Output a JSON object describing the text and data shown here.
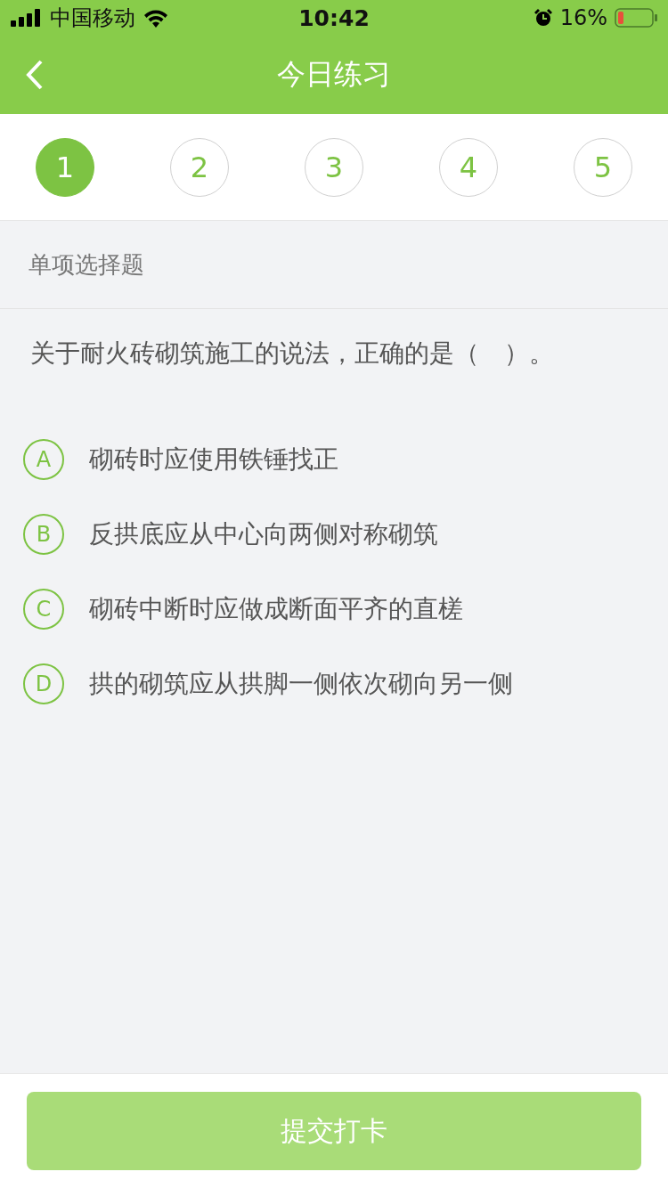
{
  "status_bar": {
    "carrier": "中国移动",
    "time": "10:42",
    "battery": "16%"
  },
  "nav": {
    "title": "今日练习"
  },
  "steps": [
    {
      "label": "1",
      "selected": true
    },
    {
      "label": "2",
      "selected": false
    },
    {
      "label": "3",
      "selected": false
    },
    {
      "label": "4",
      "selected": false
    },
    {
      "label": "5",
      "selected": false
    }
  ],
  "question": {
    "type_label": "单项选择题",
    "text": "关于耐火砖砌筑施工的说法，正确的是（　）。",
    "options": [
      {
        "letter": "A",
        "text": "砌砖时应使用铁锤找正",
        "selected": false
      },
      {
        "letter": "B",
        "text": "反拱底应从中心向两侧对称砌筑",
        "selected": false
      },
      {
        "letter": "C",
        "text": "砌砖中断时应做成断面平齐的直槎",
        "selected": false
      },
      {
        "letter": "D",
        "text": "拱的砌筑应从拱脚一侧依次砌向另一侧",
        "selected": false
      }
    ]
  },
  "submit": {
    "label": "提交打卡",
    "disabled": true
  }
}
